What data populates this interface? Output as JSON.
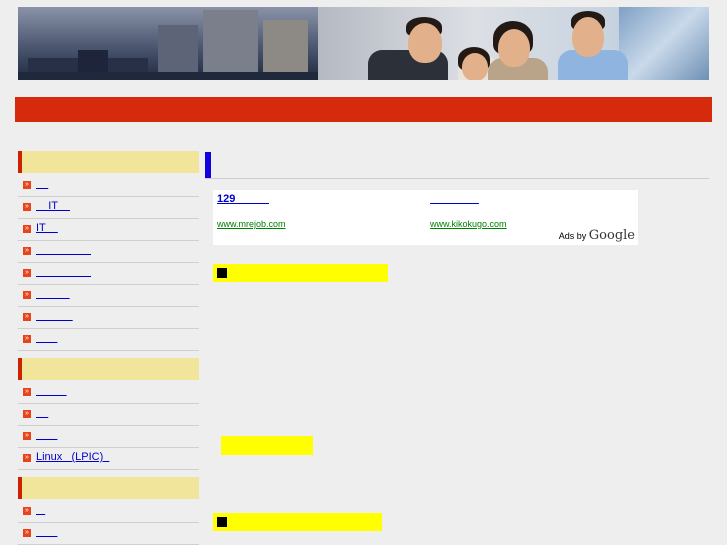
{
  "banner": {
    "alt": ""
  },
  "sidebar": {
    "sections": [
      {
        "title": "",
        "items": [
          {
            "label": "    "
          },
          {
            "label": "    IT    "
          },
          {
            "label": "IT    "
          },
          {
            "label": "                  "
          },
          {
            "label": "                  "
          },
          {
            "label": "           "
          },
          {
            "label": "            "
          },
          {
            "label": "       "
          }
        ]
      },
      {
        "title": "",
        "items": [
          {
            "label": "          "
          },
          {
            "label": "    "
          },
          {
            "label": "       "
          },
          {
            "label": "Linux   (LPIC)  "
          }
        ]
      },
      {
        "title": "",
        "items": [
          {
            "label": "   "
          },
          {
            "label": "       "
          }
        ]
      }
    ]
  },
  "main": {
    "heading": "",
    "ads": [
      {
        "title": "129           ",
        "url": "www.mrejob.com"
      },
      {
        "title": "                ",
        "url": "www.kikokugo.com"
      }
    ],
    "ads_by": "Ads by",
    "ads_brand": "Google",
    "boxes": [
      {
        "label": ""
      },
      {
        "label": ""
      },
      {
        "label": ""
      }
    ]
  },
  "colors": {
    "red_bar": "#d62a0c",
    "category_bg": "#f1e59b",
    "highlight": "#ffff00",
    "accent_blue": "#1100dd"
  }
}
